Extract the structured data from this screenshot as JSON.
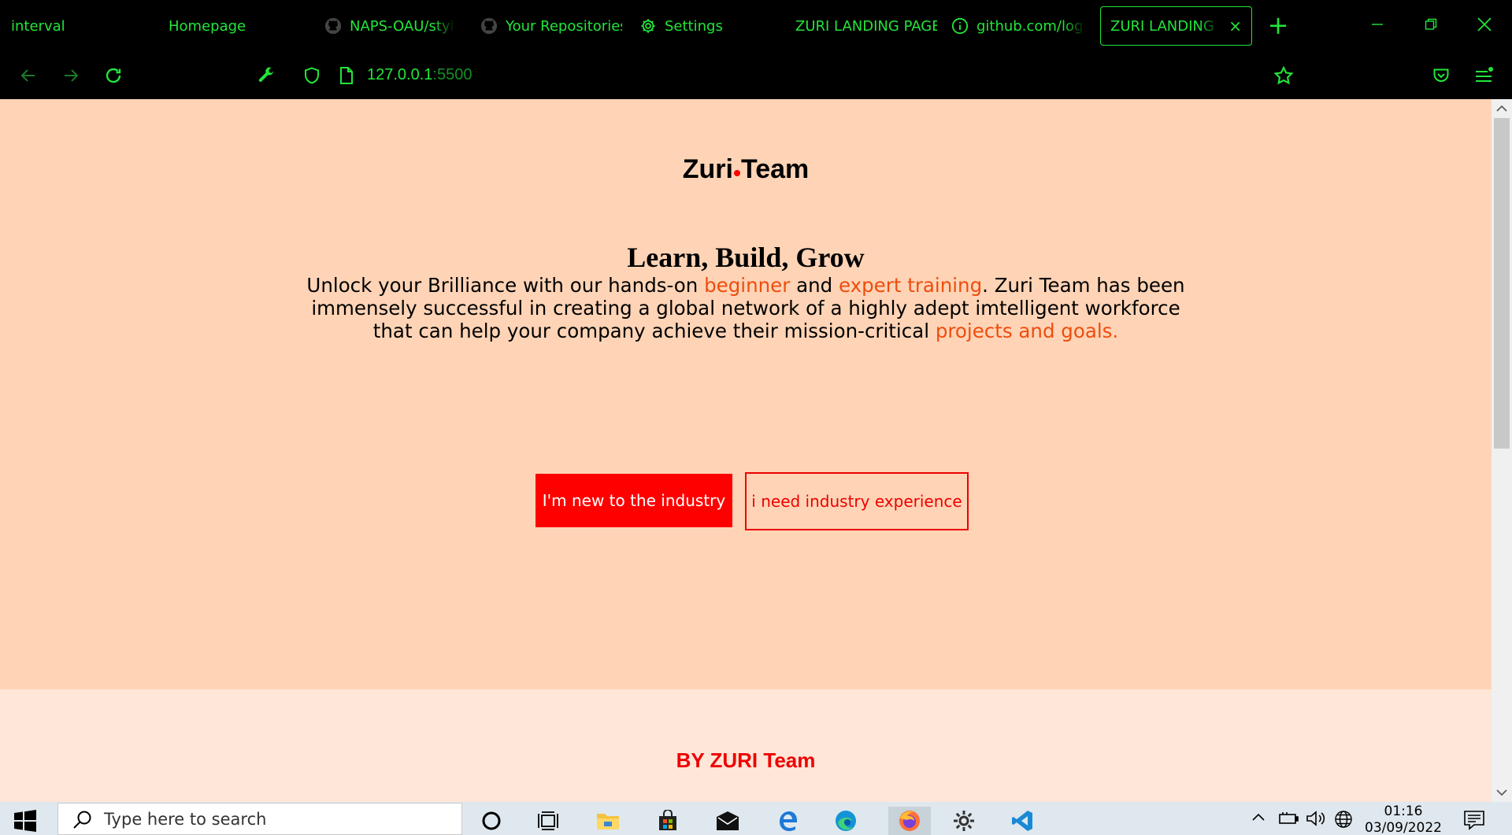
{
  "browser": {
    "tabs": [
      {
        "label": "interval",
        "icon": null,
        "active": false
      },
      {
        "label": "Homepage",
        "icon": null,
        "active": false
      },
      {
        "label": "NAPS-OAU/style",
        "icon": "github-icon",
        "active": false
      },
      {
        "label": "Your Repositories",
        "icon": "github-icon",
        "active": false
      },
      {
        "label": "Settings",
        "icon": "gear-icon",
        "active": false
      },
      {
        "label": "ZURI LANDING PAGE",
        "icon": null,
        "active": false
      },
      {
        "label": "github.com/login",
        "icon": "info-icon",
        "active": false
      },
      {
        "label": "ZURI LANDING PAGE",
        "icon": null,
        "active": true
      }
    ],
    "new_tab_label": "+",
    "tab_close": "×",
    "url_host": "127.0.0.1",
    "url_port": ":5500",
    "accent_color": "#22e53a"
  },
  "page": {
    "logo_left": "Zuri",
    "logo_right": "Team",
    "headline": "Learn, Build, Grow",
    "intro": {
      "p1": "Unlock your Brilliance with our hands-on ",
      "hl1": "beginner",
      "p2": " and ",
      "hl2": "expert training",
      "p3": ". Zuri Team has been immensely successful in creating a global network of a highly adept imtelligent workforce that can help your company achieve their mission-critical ",
      "hl3": "projects and goals."
    },
    "primary_button": "I'm new to the industry",
    "secondary_button": "i need industry experience",
    "footer_heading": "BY ZURI Team",
    "colors": {
      "background": "#ffd4b6",
      "footer_background": "#ffe6d8",
      "highlight": "#ee4d0e",
      "button_red": "#ff0000"
    }
  },
  "taskbar": {
    "search_placeholder": "Type here to search",
    "time": "01:16",
    "date": "03/09/2022"
  }
}
